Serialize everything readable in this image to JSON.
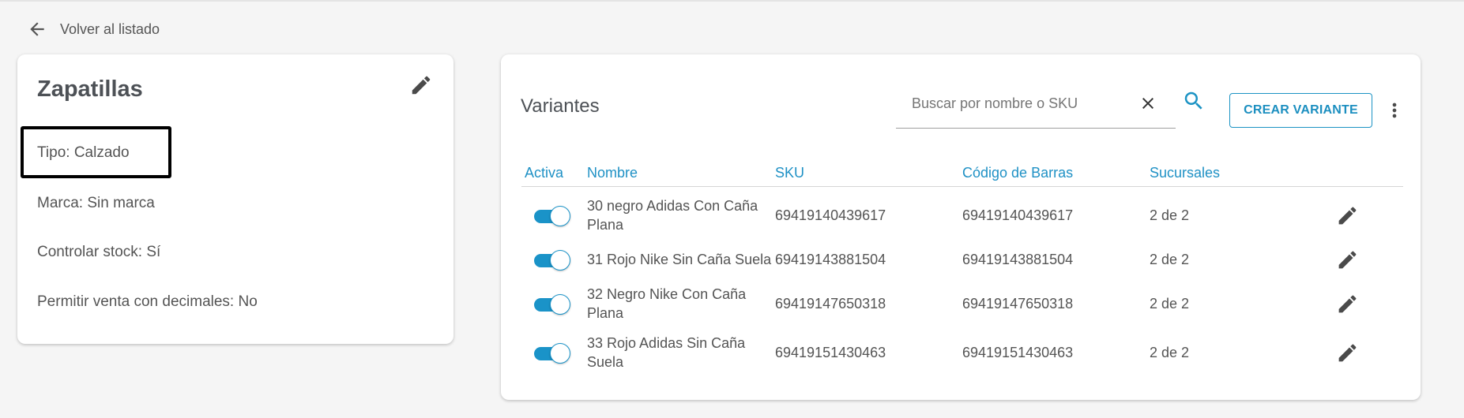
{
  "nav": {
    "back_label": "Volver al listado"
  },
  "product": {
    "title": "Zapatillas",
    "attributes": {
      "tipo": "Tipo: Calzado",
      "marca": "Marca: Sin marca",
      "stock": "Controlar stock: Sí",
      "decimales": "Permitir venta con decimales: No"
    }
  },
  "variants": {
    "title": "Variantes",
    "search_placeholder": "Buscar por nombre o SKU",
    "search_value": "",
    "create_label": "CREAR VARIANTE",
    "columns": [
      "Activa",
      "Nombre",
      "SKU",
      "Código de Barras",
      "Sucursales"
    ],
    "rows": [
      {
        "active": true,
        "name": "30 negro Adidas Con Caña Plana",
        "sku": "69419140439617",
        "barcode": "69419140439617",
        "branches": "2 de 2"
      },
      {
        "active": true,
        "name": "31 Rojo Nike Sin Caña Suela",
        "sku": "69419143881504",
        "barcode": "69419143881504",
        "branches": "2 de 2"
      },
      {
        "active": true,
        "name": "32 Negro Nike Con Caña Plana",
        "sku": "69419147650318",
        "barcode": "69419147650318",
        "branches": "2 de 2"
      },
      {
        "active": true,
        "name": "33 Rojo Adidas Sin Caña Suela",
        "sku": "69419151430463",
        "barcode": "69419151430463",
        "branches": "2 de 2"
      }
    ]
  },
  "colors": {
    "accent": "#1c93c4",
    "text": "#545454",
    "background": "#f5f5f5"
  },
  "icons": {
    "back": "arrow-left-icon",
    "edit": "pencil-icon",
    "clear": "close-icon",
    "search": "search-icon",
    "more": "more-vert-icon"
  }
}
